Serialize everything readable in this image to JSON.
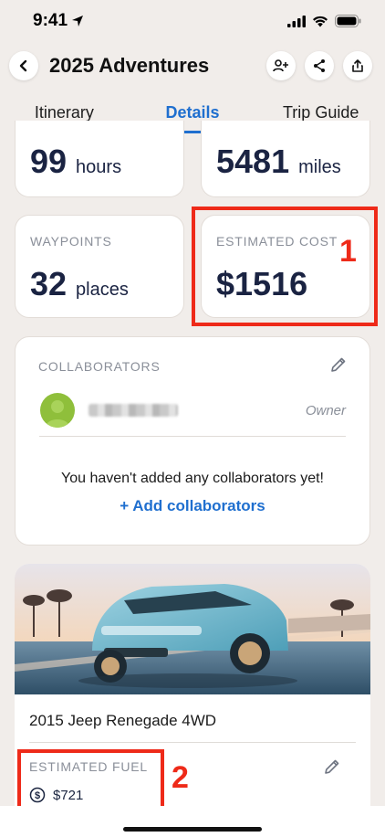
{
  "status": {
    "time": "9:41"
  },
  "header": {
    "title": "2025 Adventures"
  },
  "tabs": [
    {
      "label": "Itinerary"
    },
    {
      "label": "Details"
    },
    {
      "label": "Trip Guide"
    }
  ],
  "stats": {
    "hours": {
      "value": "99",
      "unit": "hours"
    },
    "miles": {
      "value": "5481",
      "unit": "miles"
    },
    "waypoints": {
      "label": "WAYPOINTS",
      "value": "32",
      "unit": "places"
    },
    "cost": {
      "label": "ESTIMATED COST",
      "value": "$1516"
    }
  },
  "collaborators": {
    "label": "COLLABORATORS",
    "owner_role": "Owner",
    "empty_message": "You haven't added any collaborators yet!",
    "add_label": "+ Add collaborators"
  },
  "vehicle": {
    "name": "2015 Jeep Renegade 4WD",
    "fuel_label": "ESTIMATED FUEL",
    "fuel_value": "$721"
  },
  "annotations": [
    "1",
    "2"
  ],
  "colors": {
    "accent": "#1f6fcf",
    "annotation": "#ee2a19",
    "background": "#f1edea"
  }
}
